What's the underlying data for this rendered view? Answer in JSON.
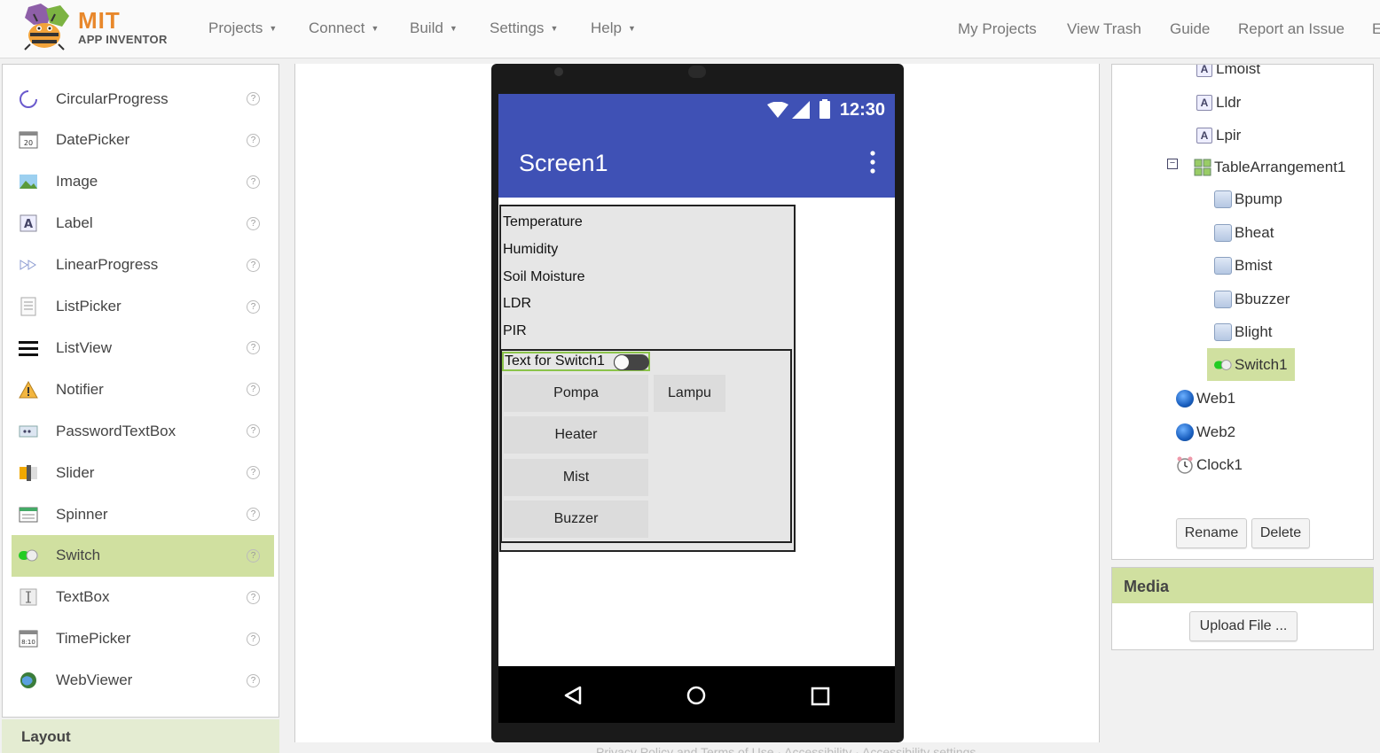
{
  "brand": {
    "name": "MIT",
    "subtitle": "APP INVENTOR"
  },
  "menus": [
    {
      "label": "Projects"
    },
    {
      "label": "Connect"
    },
    {
      "label": "Build"
    },
    {
      "label": "Settings"
    },
    {
      "label": "Help"
    }
  ],
  "right_links": [
    "My Projects",
    "View Trash",
    "Guide",
    "Report an Issue",
    "E"
  ],
  "palette": {
    "items": [
      {
        "label": "CircularProgress",
        "icon": "circular-progress-icon"
      },
      {
        "label": "DatePicker",
        "icon": "datepicker-icon"
      },
      {
        "label": "Image",
        "icon": "image-icon"
      },
      {
        "label": "Label",
        "icon": "label-icon"
      },
      {
        "label": "LinearProgress",
        "icon": "linear-progress-icon"
      },
      {
        "label": "ListPicker",
        "icon": "listpicker-icon"
      },
      {
        "label": "ListView",
        "icon": "listview-icon"
      },
      {
        "label": "Notifier",
        "icon": "notifier-icon"
      },
      {
        "label": "PasswordTextBox",
        "icon": "password-icon"
      },
      {
        "label": "Slider",
        "icon": "slider-icon"
      },
      {
        "label": "Spinner",
        "icon": "spinner-icon"
      },
      {
        "label": "Switch",
        "icon": "switch-icon",
        "selected": true
      },
      {
        "label": "TextBox",
        "icon": "textbox-icon"
      },
      {
        "label": "TimePicker",
        "icon": "timepicker-icon"
      },
      {
        "label": "WebViewer",
        "icon": "webviewer-icon"
      }
    ],
    "help_glyph": "?",
    "next_section": "Layout"
  },
  "phone": {
    "time": "12:30",
    "screen_title": "Screen1",
    "labels": [
      "Temperature",
      "Humidity",
      "Soil Moisture",
      "LDR",
      "PIR"
    ],
    "switch_text": "Text for Switch1",
    "buttons_col1": [
      "Pompa",
      "Heater",
      "Mist",
      "Buzzer"
    ],
    "buttons_col2": [
      "Lampu"
    ]
  },
  "tree": {
    "items": [
      {
        "label": "Lmoist",
        "icon": "label-icon"
      },
      {
        "label": "Lldr",
        "icon": "label-icon"
      },
      {
        "label": "Lpir",
        "icon": "label-icon"
      },
      {
        "label": "TableArrangement1",
        "icon": "table-arrangement-icon"
      },
      {
        "label": "Bpump",
        "icon": "button-icon"
      },
      {
        "label": "Bheat",
        "icon": "button-icon"
      },
      {
        "label": "Bmist",
        "icon": "button-icon"
      },
      {
        "label": "Bbuzzer",
        "icon": "button-icon"
      },
      {
        "label": "Blight",
        "icon": "button-icon"
      },
      {
        "label": "Switch1",
        "icon": "switch-icon",
        "selected": true
      },
      {
        "label": "Web1",
        "icon": "web-icon"
      },
      {
        "label": "Web2",
        "icon": "web-icon"
      },
      {
        "label": "Clock1",
        "icon": "clock-icon"
      }
    ],
    "rename_label": "Rename",
    "delete_label": "Delete"
  },
  "media": {
    "title": "Media",
    "upload_label": "Upload File ..."
  },
  "footer": "Privacy Policy and Terms of Use · Accessibility · Accessibility settings",
  "colors": {
    "accent_green": "#d0e0a0",
    "app_bar": "#3f51b5",
    "brand_orange": "#e8882b"
  }
}
